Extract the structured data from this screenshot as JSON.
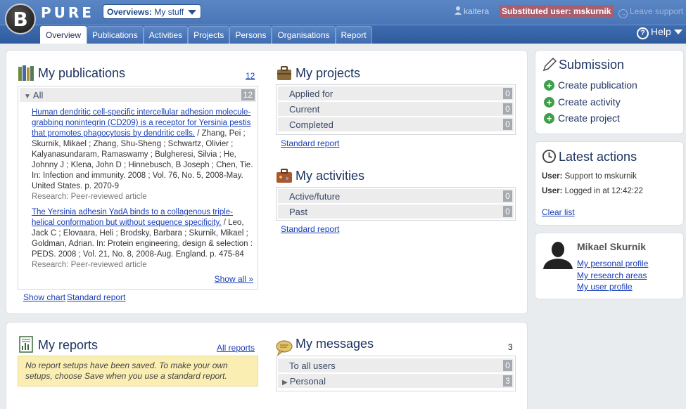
{
  "header": {
    "logo_letter": "B",
    "logo_text": "PURE",
    "overview_label": "Overviews:",
    "overview_value": "My stuff",
    "user": "kaitera",
    "substituted": "Substituted user: mskurnik",
    "leave": "Leave support",
    "help": "Help",
    "tabs": [
      "Overview",
      "Publications",
      "Activities",
      "Projects",
      "Persons",
      "Organisations",
      "Report"
    ]
  },
  "publications": {
    "title": "My publications",
    "count": "12",
    "group_label": "All",
    "group_count": "12",
    "items": [
      {
        "link": "Human dendritic cell-specific intercellular adhesion molecule-grabbing nonintegrin (CD209) is a receptor for Yersinia pestis that promotes phagocytosis by dendritic cells.",
        "details": " / Zhang, Pei ; Skurnik, Mikael ; Zhang, Shu-Sheng ; Schwartz, Olivier ; Kalyanasundaram, Ramaswamy ; Bulgheresi, Silvia ; He, Johnny J ; Klena, John D ; Hinnebusch, B Joseph ; Chen, Tie. In: Infection and immunity. 2008 ; Vol. 76, No. 5, 2008-May. United States. p. 2070-9",
        "type": "Research: Peer-reviewed article"
      },
      {
        "link": "The Yersinia adhesin YadA binds to a collagenous triple-helical conformation but without sequence specificity.",
        "details": " / Leo, Jack C ; Elovaara, Heli ; Brodsky, Barbara ; Skurnik, Mikael ; Goldman, Adrian. In: Protein engineering, design & selection : PEDS. 2008 ; Vol. 21, No. 8, 2008-Aug. England. p. 475-84",
        "type": "Research: Peer-reviewed article"
      }
    ],
    "show_all": "Show all »",
    "show_chart": "Show chart",
    "standard_report": "Standard report"
  },
  "projects": {
    "title": "My projects",
    "rows": [
      {
        "label": "Applied for",
        "count": "0"
      },
      {
        "label": "Current",
        "count": "0"
      },
      {
        "label": "Completed",
        "count": "0"
      }
    ],
    "standard_report": "Standard report"
  },
  "activities": {
    "title": "My activities",
    "rows": [
      {
        "label": "Active/future",
        "count": "0"
      },
      {
        "label": "Past",
        "count": "0"
      }
    ],
    "standard_report": "Standard report"
  },
  "submission": {
    "title": "Submission",
    "items": [
      "Create publication",
      "Create activity",
      "Create project"
    ]
  },
  "latest": {
    "title": "Latest actions",
    "items": [
      {
        "label": "User:",
        "text": "Support to mskurnik"
      },
      {
        "label": "User:",
        "text": "Logged in at 12:42:22"
      }
    ],
    "clear": "Clear list"
  },
  "profile": {
    "name": "Mikael Skurnik",
    "links": [
      "My personal profile",
      "My research areas",
      "My user profile"
    ]
  },
  "reports": {
    "title": "My reports",
    "all_reports": "All reports",
    "notice": "No report setups have been saved. To make your own setups, choose Save when you use a standard report."
  },
  "messages": {
    "title": "My messages",
    "count": "3",
    "rows": [
      {
        "label": "To all users",
        "count": "0"
      },
      {
        "label": "Personal",
        "count": "3"
      }
    ]
  }
}
